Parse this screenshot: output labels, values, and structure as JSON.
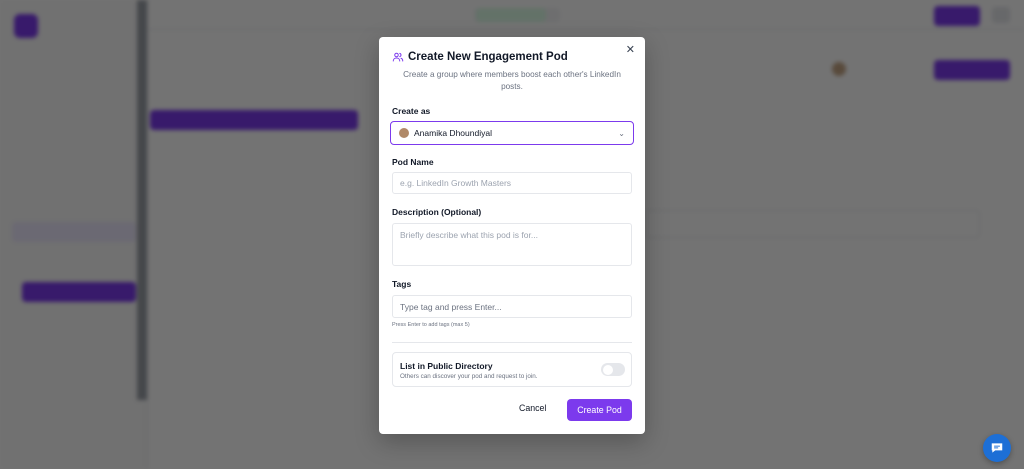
{
  "modal": {
    "title": "Create New Engagement Pod",
    "subtitle": "Create a group where members boost each other's LinkedIn posts.",
    "create_as": {
      "label": "Create as",
      "value": "Anamika Dhoundiyal"
    },
    "pod_name": {
      "label": "Pod Name",
      "placeholder": "e.g. LinkedIn Growth Masters"
    },
    "description": {
      "label": "Description (Optional)",
      "placeholder": "Briefly describe what this pod is for..."
    },
    "tags": {
      "label": "Tags",
      "placeholder": "Type tag and press Enter...",
      "hint": "Press Enter to add tags (max 5)"
    },
    "public_directory": {
      "title": "List in Public Directory",
      "subtitle": "Others can discover your pod and request to join.",
      "enabled": false
    },
    "cancel_label": "Cancel",
    "create_label": "Create Pod"
  },
  "colors": {
    "accent": "#7c3aed",
    "chat": "#1d6fd6"
  },
  "icons": {
    "header": "users-icon",
    "close": "close-icon",
    "dropdown": "chevron-down-icon",
    "chat": "chat-bubble-icon"
  }
}
